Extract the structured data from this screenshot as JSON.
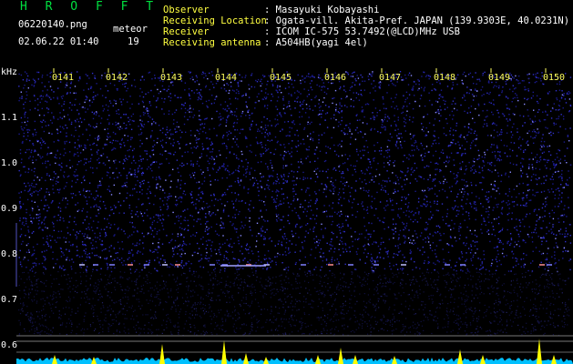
{
  "header": {
    "logo": "H R O F F T",
    "filename": "06220140.png",
    "meteor_label": "meteor",
    "datetime": "02.06.22 01:40",
    "meteor_count": "19"
  },
  "info": {
    "rows": [
      {
        "key": "Observer",
        "value": ": Masayuki Kobayashi"
      },
      {
        "key": "Receiving Location",
        "value": ": Ogata-vill. Akita-Pref. JAPAN (139.9303E, 40.0231N)"
      },
      {
        "key": "Receiver",
        "value": ": ICOM IC-575 53.7492(@LCD)MHz USB"
      },
      {
        "key": "Receiving antenna",
        "value": ": A504HB(yagi 4el)"
      }
    ]
  },
  "axis": {
    "unit": "kHz",
    "y_ticks": [
      "1.1",
      "1.0",
      "0.9",
      "0.8",
      "0.7",
      "0.6"
    ],
    "time_ticks": [
      "0141",
      "0142",
      "0143",
      "0144",
      "0145",
      "0146",
      "0147",
      "0148",
      "0149",
      "0150"
    ]
  },
  "colors": {
    "background": "#000000",
    "noise": "#1a1a8c",
    "signal": "#ffff00",
    "baseline": "#00c0ff",
    "logo": "#00e040",
    "label": "#ffff40"
  }
}
